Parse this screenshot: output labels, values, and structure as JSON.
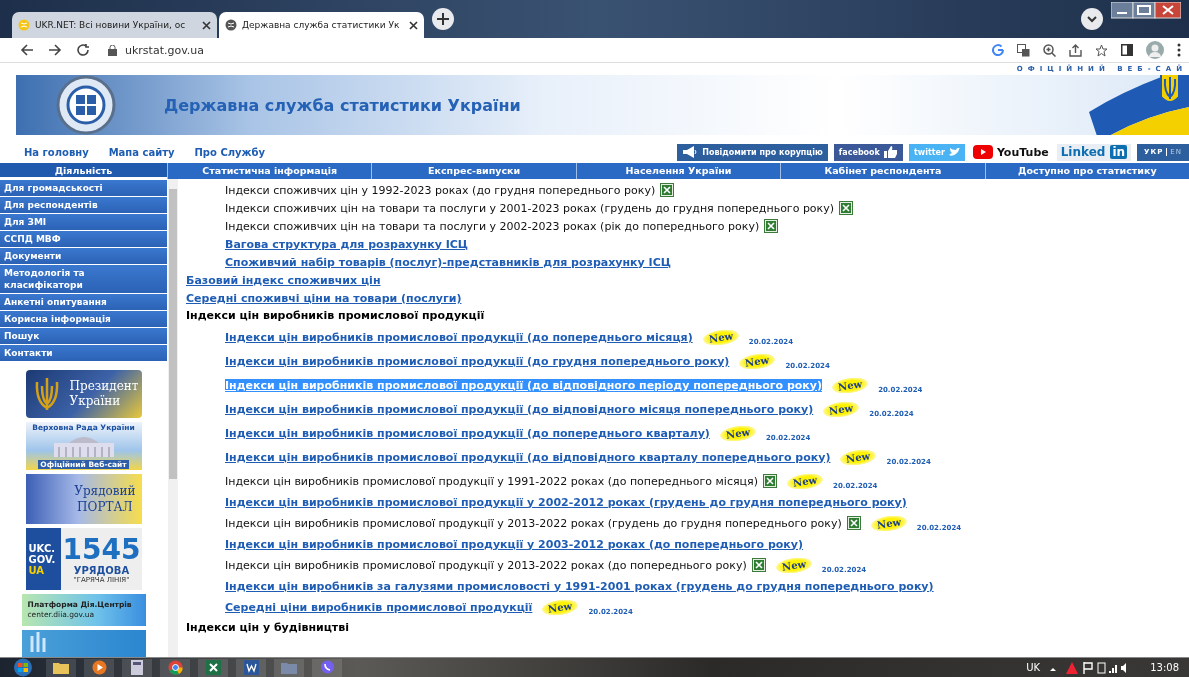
{
  "browser": {
    "tabs": [
      {
        "title": "UKR.NET: Всі новини України, ос",
        "selected": false
      },
      {
        "title": "Державна служба статистики Ук",
        "selected": true
      }
    ],
    "address": "ukrstat.gov.ua"
  },
  "header": {
    "tagline": "ОФІЦІЙНИЙ ВЕБ-САЙ",
    "title": "Державна служба статистики України",
    "nav": [
      "На головну",
      "Мапа сайту",
      "Про Службу"
    ],
    "social": [
      {
        "kind": "report",
        "label": "Повідомити про корупцію"
      },
      {
        "kind": "facebook",
        "label": "facebook"
      },
      {
        "kind": "twitter",
        "label": "twitter"
      },
      {
        "kind": "youtube",
        "label": "YouTube"
      },
      {
        "kind": "linkedin",
        "label": "Linked",
        "suffix": "in"
      },
      {
        "kind": "lang",
        "options": [
          {
            "label": "УКР",
            "selected": true
          },
          {
            "label": "EN",
            "selected": false
          }
        ]
      }
    ]
  },
  "menu": [
    {
      "label": "Діяльність",
      "selected": true
    },
    {
      "label": "Статистична інформація",
      "selected": false
    },
    {
      "label": "Експрес-випуски",
      "selected": false
    },
    {
      "label": "Населення України",
      "selected": false
    },
    {
      "label": "Кабінет респондента",
      "selected": false
    },
    {
      "label": "Доступно про статистику",
      "selected": false
    }
  ],
  "sidebar": {
    "items": [
      "Для громадськості",
      "Для респондентів",
      "Для ЗМІ",
      "ССПД МВФ",
      "Документи",
      "Методологія та класифікатори",
      "Анкетні опитування",
      "Корисна інформація",
      "Пошук",
      "Контакти"
    ],
    "banners": [
      {
        "kind": "president",
        "lines": [
          "Президент",
          "України"
        ]
      },
      {
        "kind": "rada",
        "lines": [
          "Верховна Рада України",
          "Офіційний Веб-сайт"
        ]
      },
      {
        "kind": "portal",
        "lines": [
          "Урядовий",
          "ПОРТАЛ"
        ]
      },
      {
        "kind": "hotline",
        "lines": [
          "UKC.",
          "GOV.",
          "UA",
          "1545",
          "УРЯДОВА",
          "\"ГАРЯЧА ЛІНІЯ\""
        ]
      },
      {
        "kind": "diia",
        "lines": [
          "Платформа Дія.Центрів",
          "center.diia.gov.ua"
        ]
      },
      {
        "kind": "nazk"
      }
    ]
  },
  "content": [
    {
      "children": [
        {
          "kind": "text",
          "text": "Індекси споживчих цін у 1992-2023 роках (до грудня попереднього року)",
          "excel": true,
          "highlighted": false
        },
        {
          "kind": "text",
          "text": "Індекси споживчих цін на товари та послуги у 2001-2023 роках (грудень до грудня попереднього року)",
          "excel": true,
          "highlighted": false
        },
        {
          "kind": "text",
          "text": "Індекси споживчих цін на товари та послуги у 2002-2023 роках (рік до попереднього року)",
          "excel": true,
          "highlighted": false
        },
        {
          "kind": "link",
          "text": "Вагова структура для розрахунку ІСЦ",
          "highlighted": false
        },
        {
          "kind": "link",
          "text": "Споживчий набір товарів (послуг)-представників  для розрахунку ІСЦ",
          "highlighted": false
        }
      ]
    },
    {
      "kind": "link",
      "text": "Базовий індекс споживчих цін"
    },
    {
      "kind": "link",
      "text": "Середні споживчі ціни на товари (послуги)"
    },
    {
      "kind": "heading",
      "text": "Індекси цін виробників промислової продукції",
      "children": [
        {
          "kind": "link",
          "text": "Індекси цін виробників промислової продукції (до попереднього місяця)",
          "badge": "New",
          "date": "20.02.2024",
          "highlighted": false
        },
        {
          "kind": "link",
          "text": "Індекси цін виробників промислової продукції (до грудня попереднього року)",
          "badge": "New",
          "date": "20.02.2024",
          "highlighted": false
        },
        {
          "kind": "link",
          "text": "Індекси цін виробників промислової продукції (до відповідного періоду попереднього року)",
          "badge": "New",
          "date": "20.02.2024",
          "highlighted": true
        },
        {
          "kind": "link",
          "text": "Індекси цін виробників промислової продукції (до відповідного місяця попереднього року)",
          "badge": "New",
          "date": "20.02.2024",
          "highlighted": false
        },
        {
          "kind": "link",
          "text": "Індекси цін виробників промислової продукції (до попереднього кварталу)",
          "badge": "New",
          "date": "20.02.2024",
          "highlighted": false
        },
        {
          "kind": "link",
          "text": "Індекси цін виробників промислової продукції (до відповідного кварталу попереднього року)",
          "badge": "New",
          "date": "20.02.2024",
          "highlighted": false
        },
        {
          "kind": "text",
          "text": "Індекси цін виробників промислової продукції у 1991-2022 роках (до попереднього місяця)",
          "excel": true,
          "badge": "New",
          "date": "20.02.2024",
          "highlighted": false
        },
        {
          "kind": "link",
          "text": "Індекси цін виробників промислової продукції у 2002-2012 роках (грудень до грудня попереднього року)",
          "highlighted": false
        },
        {
          "kind": "text",
          "text": "Індекси цін виробників промислової продукції у 2013-2022 роках (грудень до грудня попереднього року)",
          "excel": true,
          "badge": "New",
          "date": "20.02.2024",
          "highlighted": false
        },
        {
          "kind": "link",
          "text": "Індекси цін виробників промислової продукції у 2003-2012 роках (до попереднього року)",
          "highlighted": false
        },
        {
          "kind": "text",
          "text": "Індекси цін виробників промислової продукції у 2013-2022 роках (до попереднього року)",
          "excel": true,
          "badge": "New",
          "date": "20.02.2024",
          "highlighted": false
        },
        {
          "kind": "link",
          "text": "Індекси цін виробників за галузями промисловості у 1991-2001 роках (грудень до грудня попереднього року)",
          "highlighted": false
        },
        {
          "kind": "link",
          "text": "Середні ціни виробників промислової продукції",
          "badge": "New",
          "date": "20.02.2024",
          "highlighted": false
        }
      ]
    },
    {
      "kind": "heading",
      "text": "Індекси цін у будівництві"
    }
  ],
  "taskbar": {
    "language": "UK",
    "time": "13:08"
  }
}
